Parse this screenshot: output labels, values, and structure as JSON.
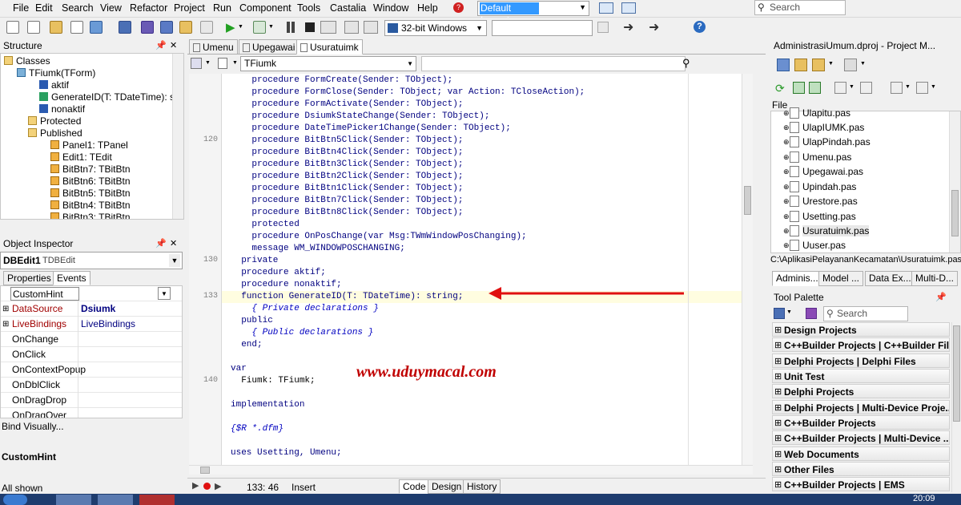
{
  "menubar": {
    "items": [
      "File",
      "Edit",
      "Search",
      "View",
      "Refactor",
      "Project",
      "Run",
      "Component",
      "Tools",
      "Castalia",
      "Window",
      "Help"
    ],
    "layout_selected": "Default Layout",
    "search_placeholder": "Search"
  },
  "toolbar": {
    "platform": "32-bit Windows"
  },
  "structure": {
    "title": "Structure",
    "tree": [
      {
        "label": "Classes",
        "level": 0
      },
      {
        "label": "TFiumk(TForm)",
        "level": 1
      },
      {
        "label": "aktif",
        "level": 2
      },
      {
        "label": "GenerateID(T: TDateTime): str",
        "level": 2
      },
      {
        "label": "nonaktif",
        "level": 2
      },
      {
        "label": "Protected",
        "level": 2
      },
      {
        "label": "Published",
        "level": 2
      },
      {
        "label": "Panel1: TPanel",
        "level": 3
      },
      {
        "label": "Edit1: TEdit",
        "level": 3
      },
      {
        "label": "BitBtn7: TBitBtn",
        "level": 3
      },
      {
        "label": "BitBtn6: TBitBtn",
        "level": 3
      },
      {
        "label": "BitBtn5: TBitBtn",
        "level": 3
      },
      {
        "label": "BitBtn4: TBitBtn",
        "level": 3
      },
      {
        "label": "BitBtn3: TBitBtn",
        "level": 3
      }
    ]
  },
  "object_inspector": {
    "title": "Object Inspector",
    "component_name": "DBEdit1",
    "component_type": "TDBEdit",
    "tabs": [
      "Properties",
      "Events"
    ],
    "filter_value": "CustomHint",
    "rows": [
      {
        "name": "CustomHint",
        "value": ""
      },
      {
        "name": "DataSource",
        "value": "Dsiumk"
      },
      {
        "name": "LiveBindings",
        "value": "LiveBindings"
      },
      {
        "name": "OnChange",
        "value": ""
      },
      {
        "name": "OnClick",
        "value": ""
      },
      {
        "name": "OnContextPopup",
        "value": ""
      },
      {
        "name": "OnDblClick",
        "value": ""
      },
      {
        "name": "OnDragDrop",
        "value": ""
      },
      {
        "name": "OnDragOver",
        "value": ""
      }
    ],
    "bind_visually": "Bind Visually...",
    "hint_title": "CustomHint",
    "status": "All shown"
  },
  "editor": {
    "tabs": [
      "Umenu",
      "Upegawai",
      "Usuratuimk"
    ],
    "class_combo": "TFiumk",
    "line_numbers": [
      {
        "label": "120",
        "row": 5
      },
      {
        "label": "130",
        "row": 15
      },
      {
        "label": "133",
        "row": 18
      },
      {
        "label": "140",
        "row": 25
      }
    ],
    "lines": [
      "    procedure FormCreate(Sender: TObject);",
      "    procedure FormClose(Sender: TObject; var Action: TCloseAction);",
      "    procedure FormActivate(Sender: TObject);",
      "    procedure DsiumkStateChange(Sender: TObject);",
      "    procedure DateTimePicker1Change(Sender: TObject);",
      "    procedure BitBtn5Click(Sender: TObject);",
      "    procedure BitBtn4Click(Sender: TObject);",
      "    procedure BitBtn3Click(Sender: TObject);",
      "    procedure BitBtn2Click(Sender: TObject);",
      "    procedure BitBtn1Click(Sender: TObject);",
      "    procedure BitBtn7Click(Sender: TObject);",
      "    procedure BitBtn8Click(Sender: TObject);",
      "    protected",
      "    procedure OnPosChange(var Msg:TWmWindowPosChanging);",
      "    message WM_WINDOWPOSCHANGING;",
      "  private",
      "  procedure aktif;",
      "  procedure nonaktif;",
      "  function GenerateID(T: TDateTime): string;",
      "    { Private declarations }",
      "  public",
      "    { Public declarations }",
      "  end;",
      "",
      "var",
      "  Fiumk: TFiumk;",
      "",
      "implementation",
      "",
      "{$R *.dfm}",
      "",
      "uses Usetting, Umenu;"
    ],
    "watermark": "www.uduymacal.com",
    "status_position": "133: 46",
    "status_mode": "Insert",
    "bottom_tabs": [
      "Code",
      "Design",
      "History"
    ]
  },
  "project_manager": {
    "title": "AdministrasiUmum.dproj - Project M...",
    "file_header": "File",
    "files": [
      "Ulapitu.pas",
      "UlapIUMK.pas",
      "UlapPindah.pas",
      "Umenu.pas",
      "Upegawai.pas",
      "Upindah.pas",
      "Urestore.pas",
      "Usetting.pas",
      "Usuratuimk.pas",
      "Uuser.pas"
    ],
    "path": "C:\\AplikasiPelayananKecamatan\\Usuratuimk.pas",
    "tabs": [
      "Adminis...",
      "Model ...",
      "Data Ex...",
      "Multi-D..."
    ]
  },
  "tool_palette": {
    "title": "Tool Palette",
    "search_placeholder": "Search",
    "categories": [
      "Design Projects",
      "C++Builder Projects | C++Builder Files",
      "Delphi Projects | Delphi Files",
      "Unit Test",
      "Delphi Projects",
      "Delphi Projects | Multi-Device Proje...",
      "C++Builder Projects",
      "C++Builder Projects | Multi-Device ...",
      "Web Documents",
      "Other Files",
      "C++Builder Projects | EMS"
    ]
  },
  "taskbar": {
    "clock": "20:09"
  }
}
